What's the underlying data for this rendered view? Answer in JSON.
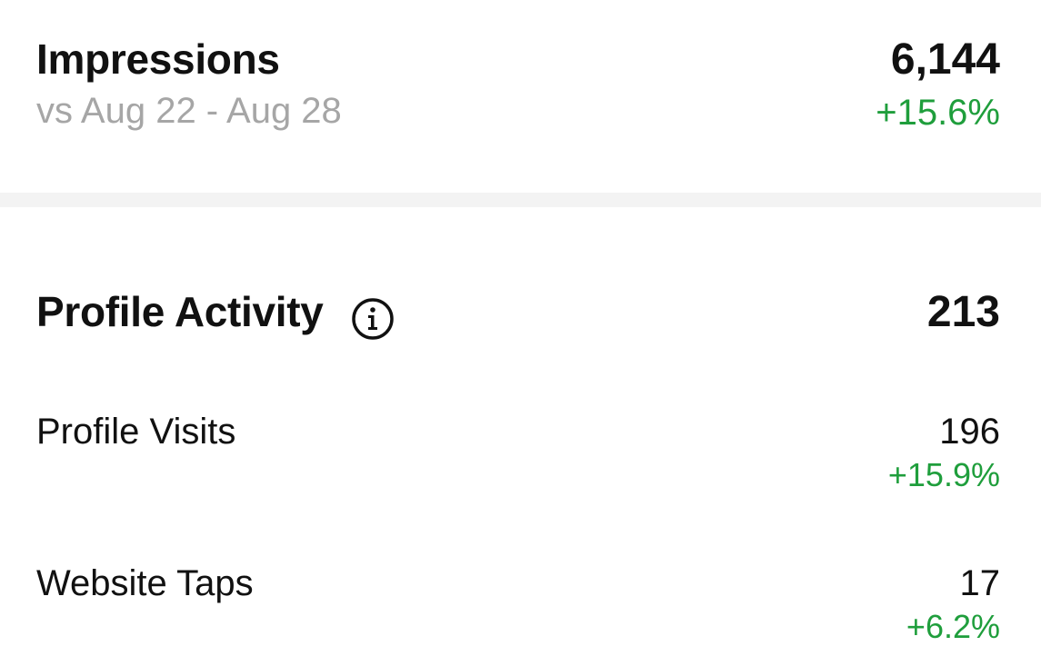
{
  "impressions": {
    "title": "Impressions",
    "comparison": "vs Aug 22 - Aug 28",
    "value": "6,144",
    "change": "+15.6%"
  },
  "profile_activity": {
    "title": "Profile Activity",
    "info_icon": "info-icon",
    "value": "213",
    "items": [
      {
        "label": "Profile Visits",
        "value": "196",
        "change": "+15.9%"
      },
      {
        "label": "Website Taps",
        "value": "17",
        "change": "+6.2%"
      }
    ]
  },
  "colors": {
    "positive": "#1f9e3c",
    "muted": "#a6a6a6",
    "divider": "#f3f3f3"
  }
}
